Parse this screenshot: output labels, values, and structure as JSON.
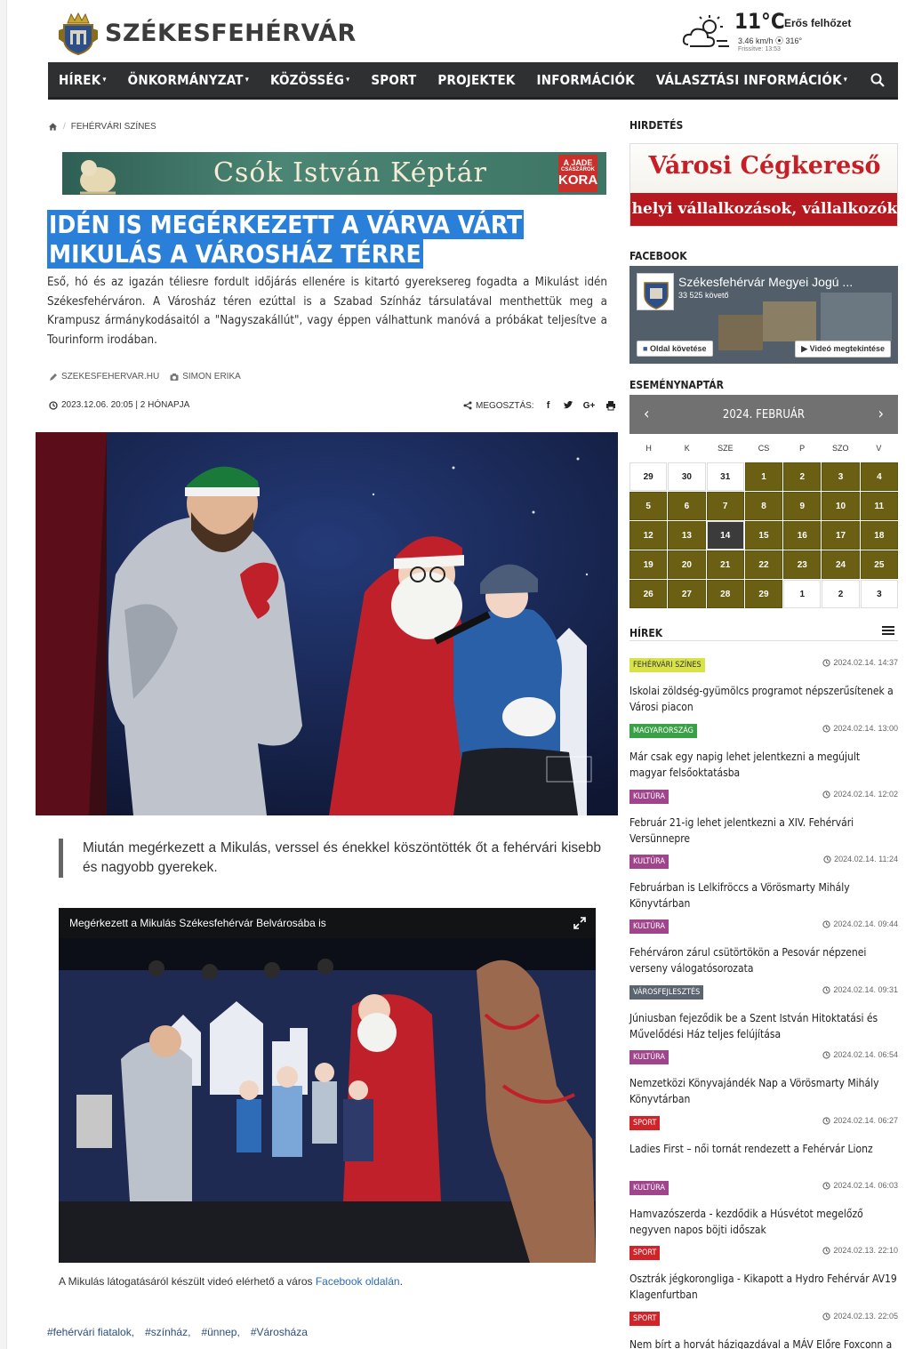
{
  "site": {
    "name": "SZÉKESFEHÉRVÁR",
    "weather": {
      "temp": "11°C",
      "condition": "Erős felhőzet",
      "wind": "3.46 km/h ⦿ 316°",
      "updated": "Frissítve: 13:53"
    }
  },
  "nav": {
    "items": [
      {
        "label": "HÍREK",
        "caret": true
      },
      {
        "label": "ÖNKORMÁNYZAT",
        "caret": true
      },
      {
        "label": "KÖZÖSSÉG",
        "caret": true
      },
      {
        "label": "SPORT",
        "caret": false
      },
      {
        "label": "PROJEKTEK",
        "caret": false
      },
      {
        "label": "INFORMÁCIÓK",
        "caret": false
      },
      {
        "label": "VÁLASZTÁSI INFORMÁCIÓK",
        "caret": true
      }
    ]
  },
  "breadcrumb": {
    "section": "FEHÉRVÁRI SZÍNES"
  },
  "banner": {
    "text": "Csók István Képtár",
    "badge_line1": "A JADE",
    "badge_line2": "CSÁSZÁROK",
    "badge_line3": "KORA"
  },
  "article": {
    "title": "IDÉN IS MEGÉRKEZETT A VÁRVA VÁRT MIKULÁS A VÁROSHÁZ TÉRRE",
    "lead": "Eső, hó és az igazán téliesre fordult időjárás ellenére is kitartó gyereksereg fogadta a Mikulást idén Székesfehérváron. A Városház téren ezúttal is a Szabad Színház társulatával menthettük meg a Krampusz ármánykodásaitól a \"Nagyszakállút\", vagy éppen válhattunk manóvá a próbákat teljesítve a Tourinform irodában.",
    "source": "SZEKESFEHERVAR.HU",
    "photographer": "SIMON ERIKA",
    "datetime": "2023.12.06. 20:05 | 2 HÓNAPJA",
    "share_label": "MEGOSZTÁS:",
    "quote": "Miután megérkezett a Mikulás, verssel és énekkel köszöntötték őt a fehérvári kisebb és nagyobb gyerekek.",
    "video_title": "Megérkezett a Mikulás Székesfehérvár Belvárosába is",
    "caption_prefix": "A Mikulás látogatásáról készült videó elérhető a város ",
    "caption_link": "Facebook oldalán",
    "caption_suffix": ".",
    "tags": [
      "#fehérvári fiatalok,",
      "#színház,",
      "#ünnep,",
      "#Városháza"
    ]
  },
  "sidebar": {
    "ad_heading": "HIRDETÉS",
    "ad_title": "Városi Cégkereső",
    "ad_subtitle": "helyi vállalkozások, vállalkozók",
    "fb_heading": "FACEBOOK",
    "fb_name": "Székesfehérvár Megyei Jogú ...",
    "fb_followers": "33 525 követő",
    "fb_follow": "Oldal követése",
    "fb_video": "Videó megtekintése",
    "cal_heading": "ESEMÉNYNAPTÁR",
    "cal_month": "2024. FEBRUÁR",
    "cal_days": [
      "H",
      "K",
      "SZE",
      "CS",
      "P",
      "SZO",
      "V"
    ],
    "cal_cells": [
      {
        "d": "29",
        "t": "pl"
      },
      {
        "d": "30",
        "t": "pl"
      },
      {
        "d": "31",
        "t": "pl"
      },
      {
        "d": "1",
        "t": "ev"
      },
      {
        "d": "2",
        "t": "ev"
      },
      {
        "d": "3",
        "t": "ev"
      },
      {
        "d": "4",
        "t": "ev"
      },
      {
        "d": "5",
        "t": "ev"
      },
      {
        "d": "6",
        "t": "ev"
      },
      {
        "d": "7",
        "t": "ev"
      },
      {
        "d": "8",
        "t": "ev"
      },
      {
        "d": "9",
        "t": "ev"
      },
      {
        "d": "10",
        "t": "ev"
      },
      {
        "d": "11",
        "t": "ev"
      },
      {
        "d": "12",
        "t": "ev"
      },
      {
        "d": "13",
        "t": "ev"
      },
      {
        "d": "14",
        "t": "today"
      },
      {
        "d": "15",
        "t": "ev"
      },
      {
        "d": "16",
        "t": "ev"
      },
      {
        "d": "17",
        "t": "ev"
      },
      {
        "d": "18",
        "t": "ev"
      },
      {
        "d": "19",
        "t": "ev"
      },
      {
        "d": "20",
        "t": "ev"
      },
      {
        "d": "21",
        "t": "ev"
      },
      {
        "d": "22",
        "t": "ev"
      },
      {
        "d": "23",
        "t": "ev"
      },
      {
        "d": "24",
        "t": "ev"
      },
      {
        "d": "25",
        "t": "ev"
      },
      {
        "d": "26",
        "t": "ev"
      },
      {
        "d": "27",
        "t": "ev"
      },
      {
        "d": "28",
        "t": "ev"
      },
      {
        "d": "29",
        "t": "ev"
      },
      {
        "d": "1",
        "t": "pl"
      },
      {
        "d": "2",
        "t": "pl"
      },
      {
        "d": "3",
        "t": "pl"
      }
    ],
    "news_heading": "HÍREK",
    "news": [
      {
        "cat": "FEHÉRVÁRI SZÍNES",
        "color": "#d8e34a",
        "tc": "#333",
        "date": "2024.02.14. 14:37",
        "title": "Iskolai zöldség-gyümölcs programot népszerűsítenek a Városi piacon"
      },
      {
        "cat": "MAGYARORSZÁG",
        "color": "#3aa048",
        "tc": "#fff",
        "date": "2024.02.14. 13:00",
        "title": "Már csak egy napig lehet jelentkezni a megújult magyar felsőoktatásba"
      },
      {
        "cat": "KULTÚRA",
        "color": "#a0448c",
        "tc": "#fff",
        "date": "2024.02.14. 12:02",
        "title": "Február 21-ig lehet jelentkezni a XIV. Fehérvári Versünnepre"
      },
      {
        "cat": "KULTÚRA",
        "color": "#a0448c",
        "tc": "#fff",
        "date": "2024.02.14. 11:24",
        "title": "Februárban is Lelkifröccs a Vörösmarty Mihály Könyvtárban"
      },
      {
        "cat": "KULTÚRA",
        "color": "#a0448c",
        "tc": "#fff",
        "date": "2024.02.14. 09:44",
        "title": "Fehérváron zárul csütörtökön a Pesovár népzenei verseny válogatósorozata"
      },
      {
        "cat": "VÁROSFEJLESZTÉS",
        "color": "#5a6570",
        "tc": "#fff",
        "date": "2024.02.14. 09:31",
        "title": "Júniusban fejeződik be a Szent István Hitoktatási és Művelődési Ház teljes felújítása"
      },
      {
        "cat": "KULTÚRA",
        "color": "#a0448c",
        "tc": "#fff",
        "date": "2024.02.14. 06:54",
        "title": "Nemzetközi Könyvajándék Nap a Vörösmarty Mihály Könyvtárban"
      },
      {
        "cat": "SPORT",
        "color": "#d0242b",
        "tc": "#fff",
        "date": "2024.02.14. 06:27",
        "title": "Ladies First – női tornát rendezett a Fehérvár Lionz"
      },
      {
        "cat": "KULTÚRA",
        "color": "#a0448c",
        "tc": "#fff",
        "date": "2024.02.14. 06:03",
        "title": "Hamvazószerda - kezdődik a Húsvétot megelőző negyven napos böjti időszak"
      },
      {
        "cat": "SPORT",
        "color": "#d0242b",
        "tc": "#fff",
        "date": "2024.02.13. 22:10",
        "title": "Osztrák jégkorongliga - Kikapott a Hydro Fehérvár AV19 Klagenfurtban"
      },
      {
        "cat": "SPORT",
        "color": "#d0242b",
        "tc": "#fff",
        "date": "2024.02.13. 22:05",
        "title": "Nem bírt a horvát házigazdával a MÁV Előre Foxconn a"
      }
    ]
  }
}
